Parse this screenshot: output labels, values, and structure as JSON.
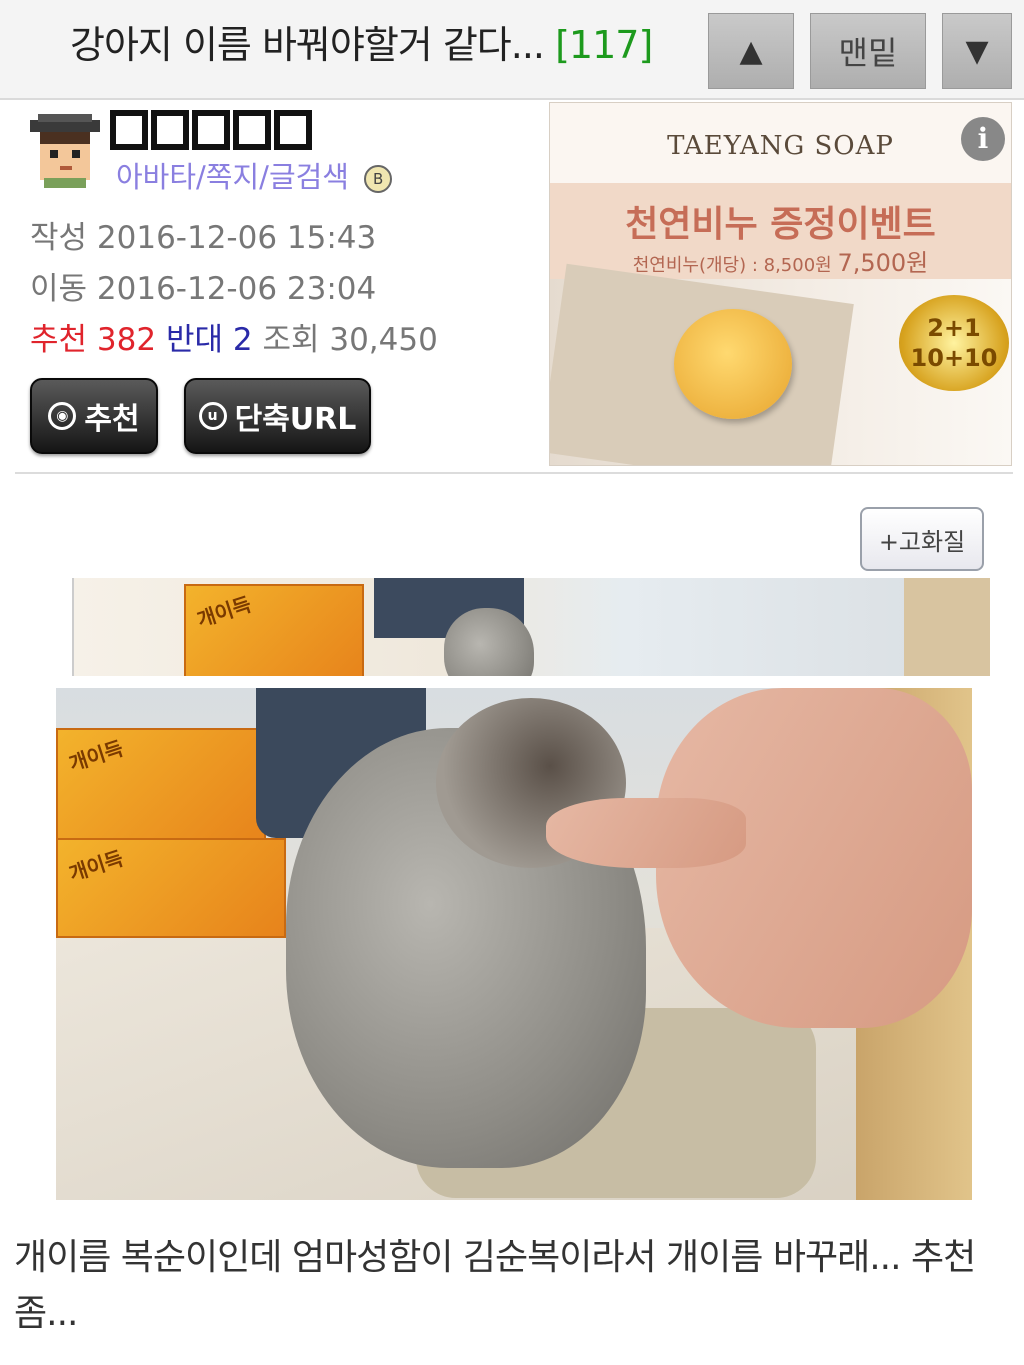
{
  "header": {
    "title": "강아지 이름 바꿔야할거 같다...",
    "comment_count": "[117]",
    "scroll_up_label": "▲",
    "bottom_label": "맨밑",
    "scroll_down_label": "▼"
  },
  "author": {
    "links_label": "아바타/쪽지/글검색",
    "written_label": "작성",
    "written_date": "2016-12-06 15:43",
    "moved_label": "이동",
    "moved_date": "2016-12-06 23:04",
    "recommend_label": "추천",
    "recommend_count": "382",
    "oppose_label": "반대",
    "oppose_count": "2",
    "views_label": "조회",
    "views_count": "30,450"
  },
  "actions": {
    "recommend_button": "추천",
    "shorturl_button": "단축URL"
  },
  "ad": {
    "brand": "TAEYANG SOAP",
    "headline": "천연비누 증정이벤트",
    "price_text": "천연비누(개당) : 8,500원",
    "price_sale": "7,500원",
    "seal_text": "2+1\n10+10",
    "info_icon": "i"
  },
  "content": {
    "hq_button": "+고화질",
    "caption": "개이름 복순이인데 엄마성함이 김순복이라서 개이름 바꾸래... 추천좀..."
  }
}
